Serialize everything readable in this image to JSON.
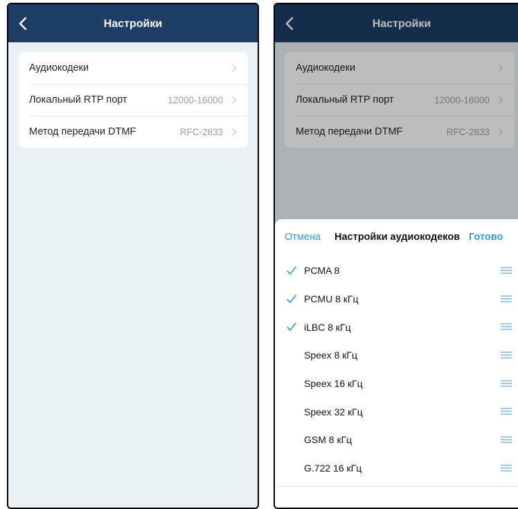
{
  "left": {
    "title": "Настройки",
    "rows": [
      {
        "label": "Аудиокодеки",
        "value": ""
      },
      {
        "label": "Локальный RTP порт",
        "value": "12000-16000"
      },
      {
        "label": "Метод передачи DTMF",
        "value": "RFC-2833"
      }
    ]
  },
  "right": {
    "title": "Настройки",
    "rows": [
      {
        "label": "Аудиокодеки",
        "value": ""
      },
      {
        "label": "Локальный RTP порт",
        "value": "12000-16000"
      },
      {
        "label": "Метод передачи DTMF",
        "value": "RFC-2833"
      }
    ],
    "sheet": {
      "cancel_label": "Отмена",
      "title": "Настройки аудиокодеков",
      "done_label": "Готово",
      "codecs": [
        {
          "label": "PCMA 8",
          "checked": true
        },
        {
          "label": "PCMU 8 кГц",
          "checked": true
        },
        {
          "label": "iLBC 8 кГц",
          "checked": true
        },
        {
          "label": "Speex 8 кГц",
          "checked": false
        },
        {
          "label": "Speex 16 кГц",
          "checked": false
        },
        {
          "label": "Speex 32 кГц",
          "checked": false
        },
        {
          "label": "GSM 8 кГц",
          "checked": false
        },
        {
          "label": "G.722 16 кГц",
          "checked": false
        }
      ]
    }
  },
  "colors": {
    "navbar": "#1b3d66",
    "accent": "#2f9be6",
    "background": "#eaf1f5"
  },
  "icons": {
    "back": "chevron-left-icon",
    "disclosure": "chevron-right-icon",
    "check": "check-icon",
    "reorder": "drag-handle-icon"
  }
}
